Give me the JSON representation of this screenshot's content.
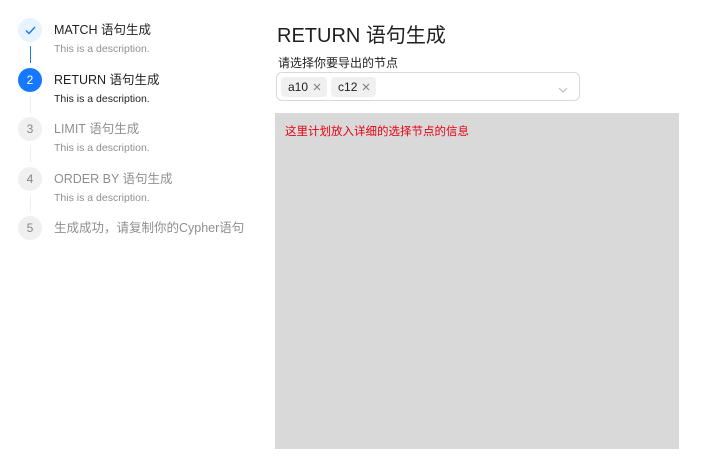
{
  "steps": [
    {
      "number": "",
      "title": "MATCH 语句生成",
      "description": "This is a description.",
      "status": "finish"
    },
    {
      "number": "2",
      "title": "RETURN 语句生成",
      "description": "This is a description.",
      "status": "process"
    },
    {
      "number": "3",
      "title": "LIMIT 语句生成",
      "description": "This is a description.",
      "status": "wait"
    },
    {
      "number": "4",
      "title": "ORDER BY 语句生成",
      "description": "This is a description.",
      "status": "wait"
    },
    {
      "number": "5",
      "title": "生成成功，请复制你的Cypher语句",
      "description": "",
      "status": "wait"
    }
  ],
  "main": {
    "title": "RETURN 语句生成",
    "select_label": "请选择你要导出的节点",
    "selected_tags": [
      "a10",
      "c12"
    ],
    "detail_placeholder": "这里计划放入详细的选择节点的信息"
  },
  "colors": {
    "primary": "#1677ff",
    "placeholder_text": "#e60012",
    "detail_background": "#d9d9d9"
  }
}
